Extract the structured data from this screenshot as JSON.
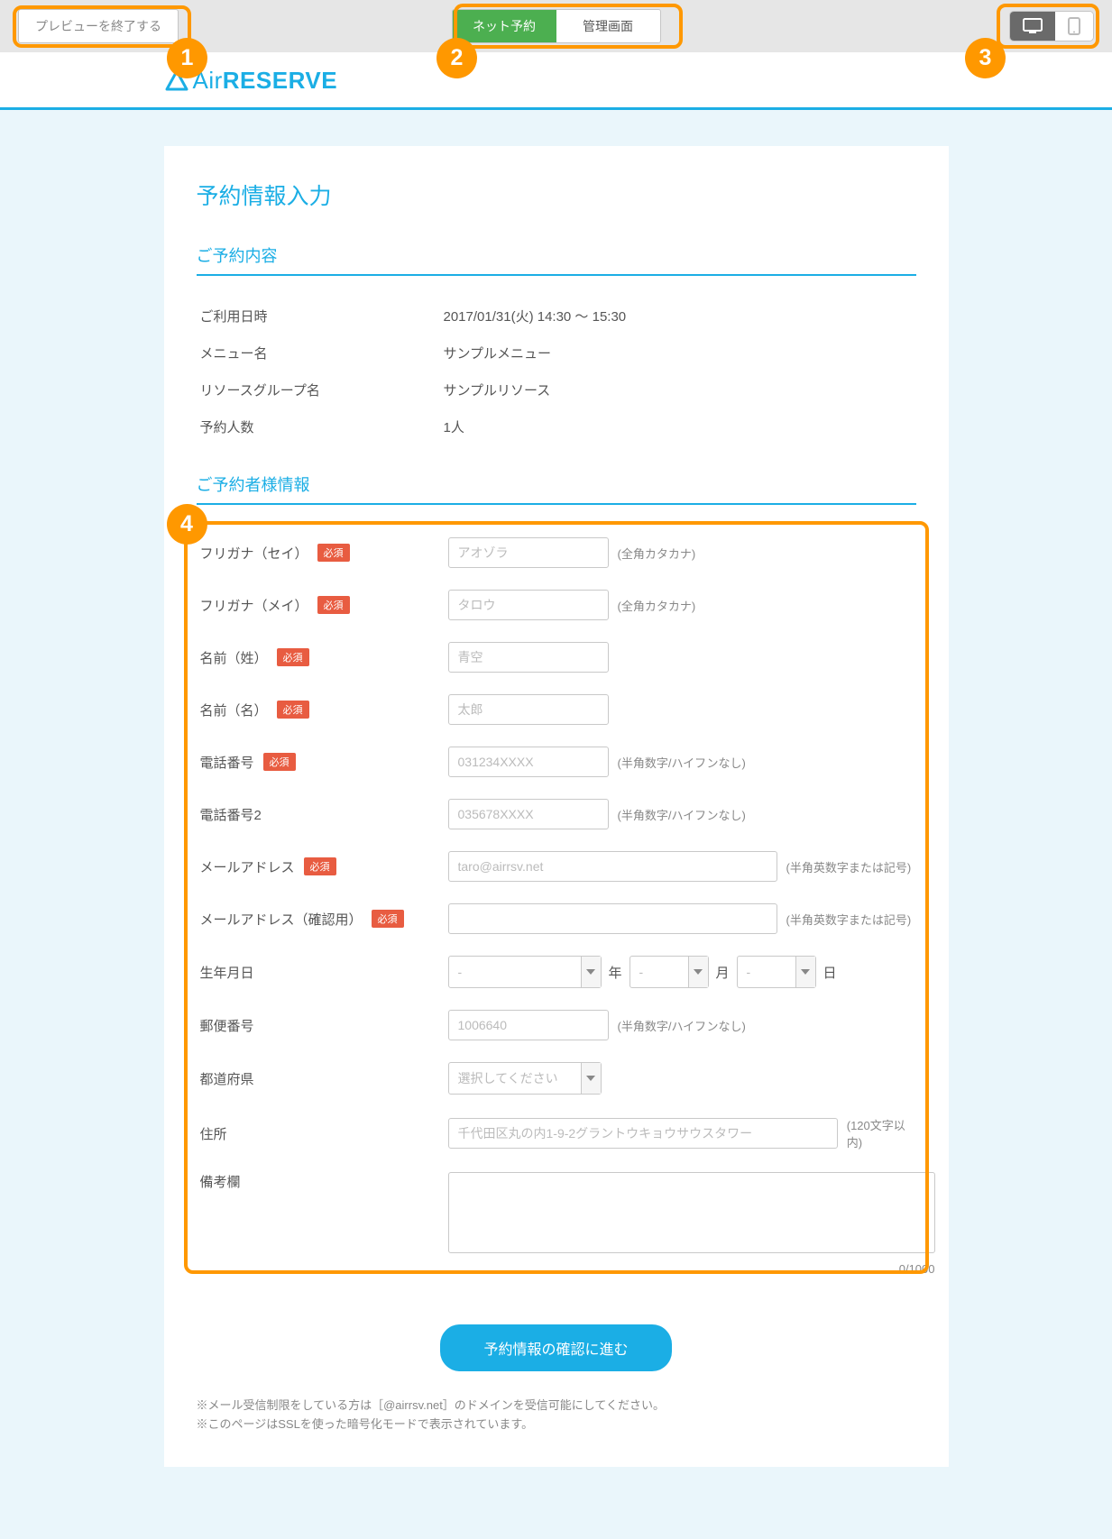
{
  "topbar": {
    "end_preview": "プレビューを終了する",
    "tab_net": "ネット予約",
    "tab_admin": "管理画面"
  },
  "badges": {
    "b1": "1",
    "b2": "2",
    "b3": "3",
    "b4": "4"
  },
  "logo": {
    "part1": "Air",
    "part2": "RESERVE"
  },
  "page_title": "予約情報入力",
  "section_summary_title": "ご予約内容",
  "summary": {
    "datetime_label": "ご利用日時",
    "datetime_value": "2017/01/31(火) 14:30 〜 15:30",
    "menu_label": "メニュー名",
    "menu_value": "サンプルメニュー",
    "resource_label": "リソースグループ名",
    "resource_value": "サンプルリソース",
    "count_label": "予約人数",
    "count_value": "1人"
  },
  "section_customer_title": "ご予約者様情報",
  "required": "必須",
  "form": {
    "furigana_sei": {
      "label": "フリガナ（セイ）",
      "placeholder": "アオゾラ",
      "hint": "(全角カタカナ)"
    },
    "furigana_mei": {
      "label": "フリガナ（メイ）",
      "placeholder": "タロウ",
      "hint": "(全角カタカナ)"
    },
    "name_sei": {
      "label": "名前（姓）",
      "placeholder": "青空"
    },
    "name_mei": {
      "label": "名前（名）",
      "placeholder": "太郎"
    },
    "tel1": {
      "label": "電話番号",
      "placeholder": "031234XXXX",
      "hint": "(半角数字/ハイフンなし)"
    },
    "tel2": {
      "label": "電話番号2",
      "placeholder": "035678XXXX",
      "hint": "(半角数字/ハイフンなし)"
    },
    "email": {
      "label": "メールアドレス",
      "placeholder": "taro@airrsv.net",
      "hint": "(半角英数字または記号)"
    },
    "email_confirm": {
      "label": "メールアドレス（確認用）",
      "hint": "(半角英数字または記号)"
    },
    "dob": {
      "label": "生年月日",
      "year": "年",
      "month": "月",
      "day": "日",
      "dash": "-"
    },
    "postal": {
      "label": "郵便番号",
      "placeholder": "1006640",
      "hint": "(半角数字/ハイフンなし)"
    },
    "pref": {
      "label": "都道府県",
      "placeholder": "選択してください"
    },
    "address": {
      "label": "住所",
      "placeholder": "千代田区丸の内1-9-2グラントウキョウサウスタワー",
      "hint": "(120文字以内)"
    },
    "remarks": {
      "label": "備考欄",
      "count": "0/1000"
    }
  },
  "submit": "予約情報の確認に進む",
  "notes": {
    "line1": "※メール受信制限をしている方は［@airrsv.net］のドメインを受信可能にしてください。",
    "line2": "※このページはSSLを使った暗号化モードで表示されています。"
  }
}
